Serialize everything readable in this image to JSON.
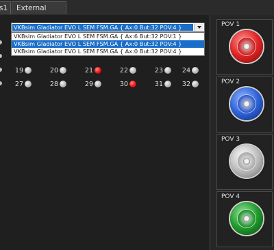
{
  "tabs": [
    {
      "label": "s1"
    },
    {
      "label": "External Devices"
    }
  ],
  "device_select": {
    "selected": "VKBsim Gladiator EVO  L SEM FSM.GA  { Ax:0 But:32 POV:4 }",
    "options": [
      {
        "label": "VKBsim Gladiator EVO  L SEM FSM.GA  { Ax:6 But:32 POV:1 }",
        "highlighted": false
      },
      {
        "label": "VKBsim Gladiator EVO  L SEM FSM.GA  { Ax:0 But:32 POV:4 }",
        "highlighted": true
      },
      {
        "label": "VKBsim Gladiator EVO  L SEM FSM.GA  { Ax:0 But:32 POV:4 }",
        "highlighted": false
      }
    ]
  },
  "buttons_row3": [
    {
      "num": "19",
      "on": false
    },
    {
      "num": "20",
      "on": false
    },
    {
      "num": "21",
      "on": true
    },
    {
      "num": "22",
      "on": false
    },
    {
      "num": "23",
      "on": false
    },
    {
      "num": "24",
      "on": false
    }
  ],
  "buttons_row4": [
    {
      "num": "27",
      "on": false
    },
    {
      "num": "28",
      "on": false
    },
    {
      "num": "29",
      "on": false
    },
    {
      "num": "30",
      "on": true
    },
    {
      "num": "31",
      "on": false
    },
    {
      "num": "32",
      "on": false
    }
  ],
  "povs": [
    {
      "label": "POV 1",
      "color": "#e02424"
    },
    {
      "label": "POV 2",
      "color": "#2f63d8"
    },
    {
      "label": "POV 3",
      "color": "#bdbdbd"
    },
    {
      "label": "POV 4",
      "color": "#1f9a2c"
    }
  ]
}
